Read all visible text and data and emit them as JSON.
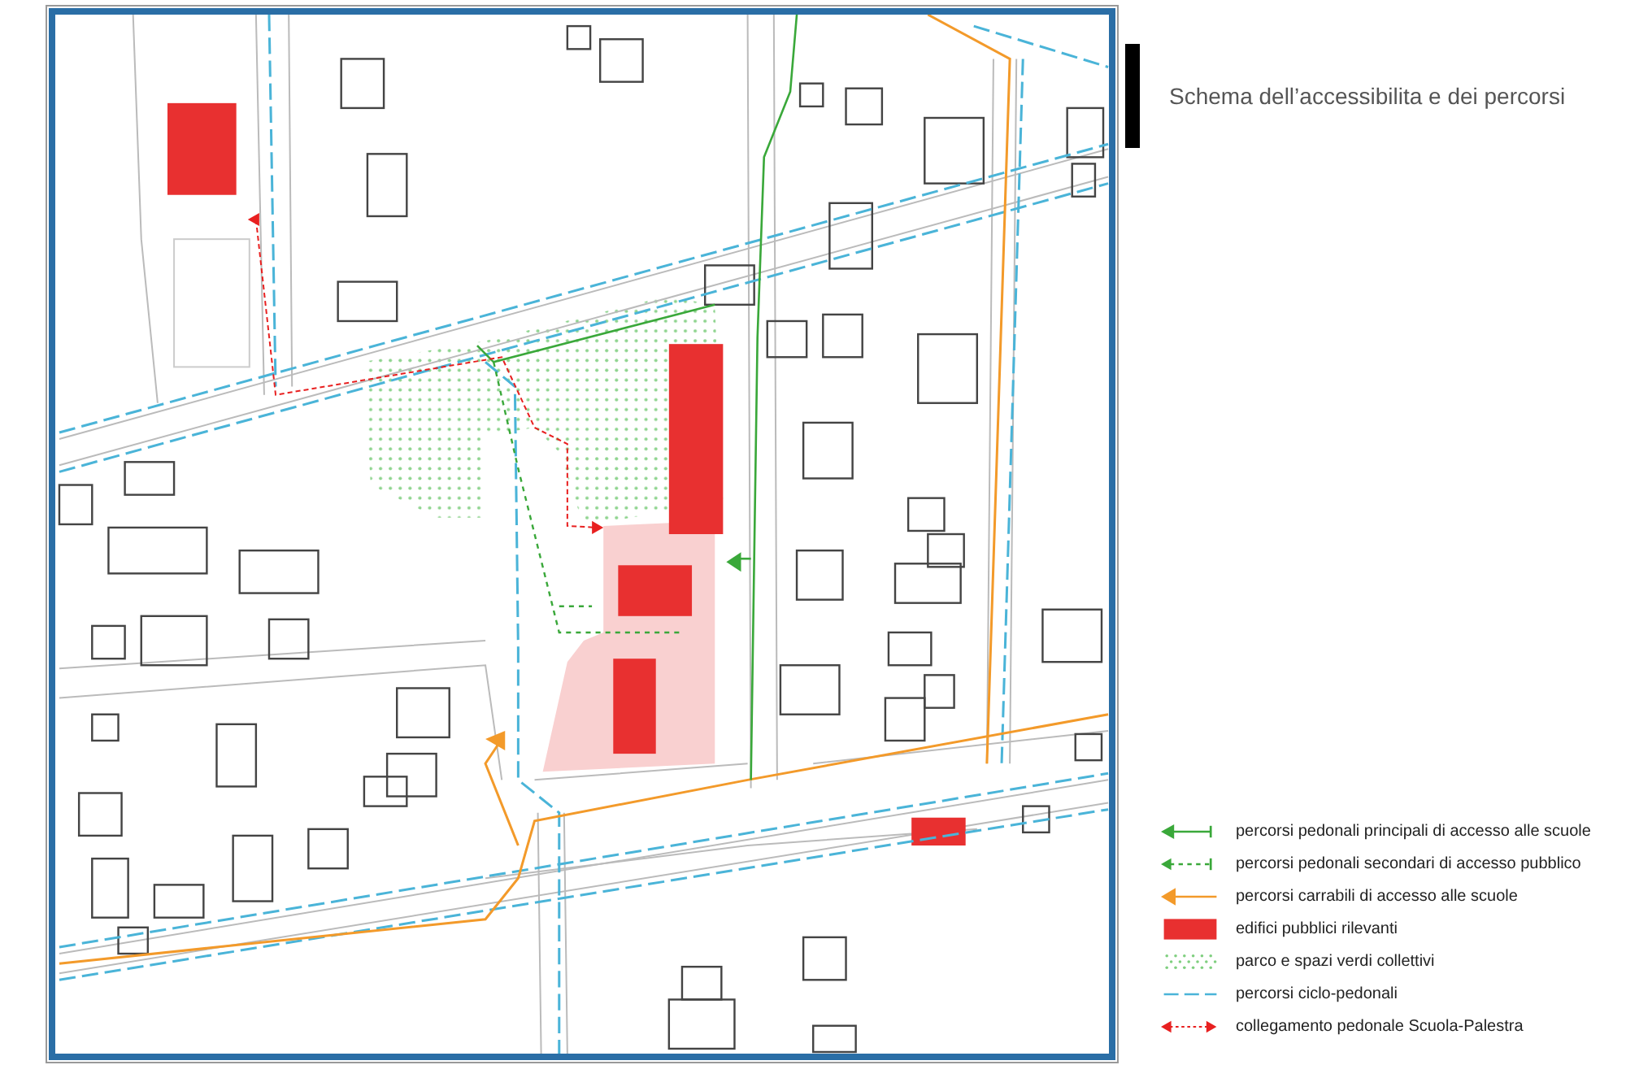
{
  "title": "Schema dell’accessibilita e dei percorsi",
  "legend": [
    {
      "kind": "arrow-solid",
      "color": "#3aa83a",
      "label": "percorsi pedonali principali di accesso alle scuole"
    },
    {
      "kind": "arrow-dotted",
      "color": "#3aa83a",
      "label": "percorsi pedonali secondari di accesso pubblico"
    },
    {
      "kind": "arrow-plain",
      "color": "#f39a2a",
      "label": "percorsi carrabili di accesso alle scuole"
    },
    {
      "kind": "block",
      "color": "#e83030",
      "label": "edifici pubblici rilevanti"
    },
    {
      "kind": "dots",
      "color": "#7fcf7f",
      "label": "parco e spazi verdi collettivi"
    },
    {
      "kind": "dash",
      "color": "#4ab4d8",
      "label": "percorsi ciclo-pedonali"
    },
    {
      "kind": "double-dotted",
      "color": "#e82020",
      "label": "collegamento pedonale Scuola-Palestra"
    }
  ]
}
